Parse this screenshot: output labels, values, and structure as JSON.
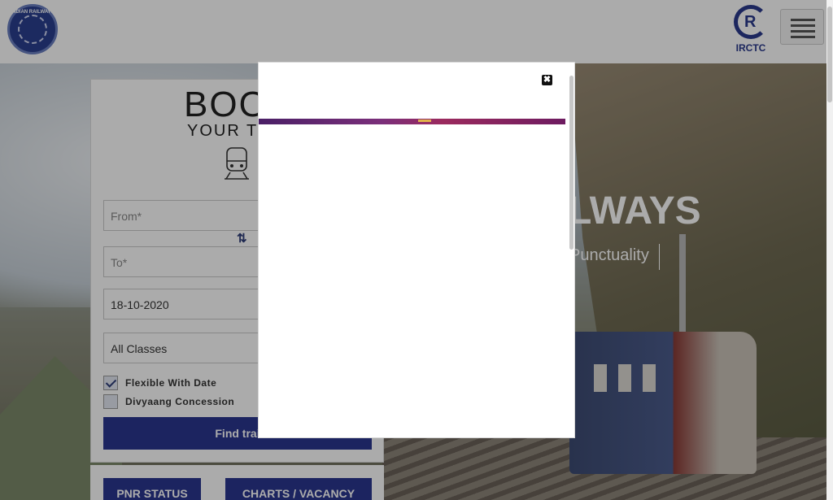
{
  "header": {
    "left_logo_text": "INDIAN RAILWAYS",
    "right_logo_label": "IRCTC",
    "menu_icon": "hamburger-icon"
  },
  "hero": {
    "title": "LWAYS",
    "subtitle": "Punctuality"
  },
  "booking": {
    "heading": "BOO",
    "subheading": "YOUR TIC",
    "from_placeholder": "From*",
    "to_placeholder": "To*",
    "date_value": "18-10-2020",
    "class_value": "All Classes",
    "flexible_label": "Flexible With Date",
    "flexible_checked": true,
    "divyaang_label": "Divyaang Concession",
    "divyaang_checked": false,
    "find_button": "Find trai",
    "swap_icon": "swap-arrows-icon",
    "train_icon": "train-icon"
  },
  "quick_links": {
    "pnr": "PNR STATUS",
    "charts": "CHARTS / VACANCY"
  },
  "modal": {
    "close_icon": "close-icon",
    "close_glyph": "✖"
  },
  "colors": {
    "primary": "#2b3790",
    "overlay": "rgba(0,0,0,0.33)",
    "banner": "#7a2f7a"
  }
}
